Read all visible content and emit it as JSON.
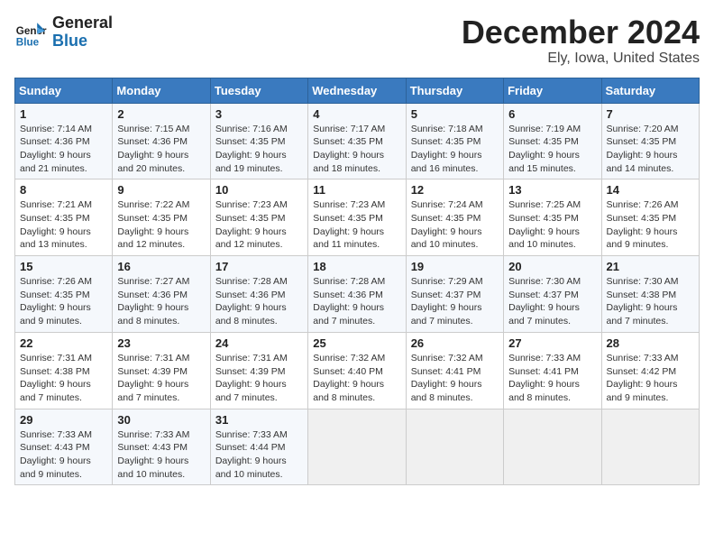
{
  "logo": {
    "text_general": "General",
    "text_blue": "Blue"
  },
  "title": "December 2024",
  "subtitle": "Ely, Iowa, United States",
  "days_of_week": [
    "Sunday",
    "Monday",
    "Tuesday",
    "Wednesday",
    "Thursday",
    "Friday",
    "Saturday"
  ],
  "weeks": [
    [
      {
        "day": "1",
        "sunrise": "Sunrise: 7:14 AM",
        "sunset": "Sunset: 4:36 PM",
        "daylight": "Daylight: 9 hours and 21 minutes."
      },
      {
        "day": "2",
        "sunrise": "Sunrise: 7:15 AM",
        "sunset": "Sunset: 4:36 PM",
        "daylight": "Daylight: 9 hours and 20 minutes."
      },
      {
        "day": "3",
        "sunrise": "Sunrise: 7:16 AM",
        "sunset": "Sunset: 4:35 PM",
        "daylight": "Daylight: 9 hours and 19 minutes."
      },
      {
        "day": "4",
        "sunrise": "Sunrise: 7:17 AM",
        "sunset": "Sunset: 4:35 PM",
        "daylight": "Daylight: 9 hours and 18 minutes."
      },
      {
        "day": "5",
        "sunrise": "Sunrise: 7:18 AM",
        "sunset": "Sunset: 4:35 PM",
        "daylight": "Daylight: 9 hours and 16 minutes."
      },
      {
        "day": "6",
        "sunrise": "Sunrise: 7:19 AM",
        "sunset": "Sunset: 4:35 PM",
        "daylight": "Daylight: 9 hours and 15 minutes."
      },
      {
        "day": "7",
        "sunrise": "Sunrise: 7:20 AM",
        "sunset": "Sunset: 4:35 PM",
        "daylight": "Daylight: 9 hours and 14 minutes."
      }
    ],
    [
      {
        "day": "8",
        "sunrise": "Sunrise: 7:21 AM",
        "sunset": "Sunset: 4:35 PM",
        "daylight": "Daylight: 9 hours and 13 minutes."
      },
      {
        "day": "9",
        "sunrise": "Sunrise: 7:22 AM",
        "sunset": "Sunset: 4:35 PM",
        "daylight": "Daylight: 9 hours and 12 minutes."
      },
      {
        "day": "10",
        "sunrise": "Sunrise: 7:23 AM",
        "sunset": "Sunset: 4:35 PM",
        "daylight": "Daylight: 9 hours and 12 minutes."
      },
      {
        "day": "11",
        "sunrise": "Sunrise: 7:23 AM",
        "sunset": "Sunset: 4:35 PM",
        "daylight": "Daylight: 9 hours and 11 minutes."
      },
      {
        "day": "12",
        "sunrise": "Sunrise: 7:24 AM",
        "sunset": "Sunset: 4:35 PM",
        "daylight": "Daylight: 9 hours and 10 minutes."
      },
      {
        "day": "13",
        "sunrise": "Sunrise: 7:25 AM",
        "sunset": "Sunset: 4:35 PM",
        "daylight": "Daylight: 9 hours and 10 minutes."
      },
      {
        "day": "14",
        "sunrise": "Sunrise: 7:26 AM",
        "sunset": "Sunset: 4:35 PM",
        "daylight": "Daylight: 9 hours and 9 minutes."
      }
    ],
    [
      {
        "day": "15",
        "sunrise": "Sunrise: 7:26 AM",
        "sunset": "Sunset: 4:35 PM",
        "daylight": "Daylight: 9 hours and 9 minutes."
      },
      {
        "day": "16",
        "sunrise": "Sunrise: 7:27 AM",
        "sunset": "Sunset: 4:36 PM",
        "daylight": "Daylight: 9 hours and 8 minutes."
      },
      {
        "day": "17",
        "sunrise": "Sunrise: 7:28 AM",
        "sunset": "Sunset: 4:36 PM",
        "daylight": "Daylight: 9 hours and 8 minutes."
      },
      {
        "day": "18",
        "sunrise": "Sunrise: 7:28 AM",
        "sunset": "Sunset: 4:36 PM",
        "daylight": "Daylight: 9 hours and 7 minutes."
      },
      {
        "day": "19",
        "sunrise": "Sunrise: 7:29 AM",
        "sunset": "Sunset: 4:37 PM",
        "daylight": "Daylight: 9 hours and 7 minutes."
      },
      {
        "day": "20",
        "sunrise": "Sunrise: 7:30 AM",
        "sunset": "Sunset: 4:37 PM",
        "daylight": "Daylight: 9 hours and 7 minutes."
      },
      {
        "day": "21",
        "sunrise": "Sunrise: 7:30 AM",
        "sunset": "Sunset: 4:38 PM",
        "daylight": "Daylight: 9 hours and 7 minutes."
      }
    ],
    [
      {
        "day": "22",
        "sunrise": "Sunrise: 7:31 AM",
        "sunset": "Sunset: 4:38 PM",
        "daylight": "Daylight: 9 hours and 7 minutes."
      },
      {
        "day": "23",
        "sunrise": "Sunrise: 7:31 AM",
        "sunset": "Sunset: 4:39 PM",
        "daylight": "Daylight: 9 hours and 7 minutes."
      },
      {
        "day": "24",
        "sunrise": "Sunrise: 7:31 AM",
        "sunset": "Sunset: 4:39 PM",
        "daylight": "Daylight: 9 hours and 7 minutes."
      },
      {
        "day": "25",
        "sunrise": "Sunrise: 7:32 AM",
        "sunset": "Sunset: 4:40 PM",
        "daylight": "Daylight: 9 hours and 8 minutes."
      },
      {
        "day": "26",
        "sunrise": "Sunrise: 7:32 AM",
        "sunset": "Sunset: 4:41 PM",
        "daylight": "Daylight: 9 hours and 8 minutes."
      },
      {
        "day": "27",
        "sunrise": "Sunrise: 7:33 AM",
        "sunset": "Sunset: 4:41 PM",
        "daylight": "Daylight: 9 hours and 8 minutes."
      },
      {
        "day": "28",
        "sunrise": "Sunrise: 7:33 AM",
        "sunset": "Sunset: 4:42 PM",
        "daylight": "Daylight: 9 hours and 9 minutes."
      }
    ],
    [
      {
        "day": "29",
        "sunrise": "Sunrise: 7:33 AM",
        "sunset": "Sunset: 4:43 PM",
        "daylight": "Daylight: 9 hours and 9 minutes."
      },
      {
        "day": "30",
        "sunrise": "Sunrise: 7:33 AM",
        "sunset": "Sunset: 4:43 PM",
        "daylight": "Daylight: 9 hours and 10 minutes."
      },
      {
        "day": "31",
        "sunrise": "Sunrise: 7:33 AM",
        "sunset": "Sunset: 4:44 PM",
        "daylight": "Daylight: 9 hours and 10 minutes."
      },
      null,
      null,
      null,
      null
    ]
  ]
}
